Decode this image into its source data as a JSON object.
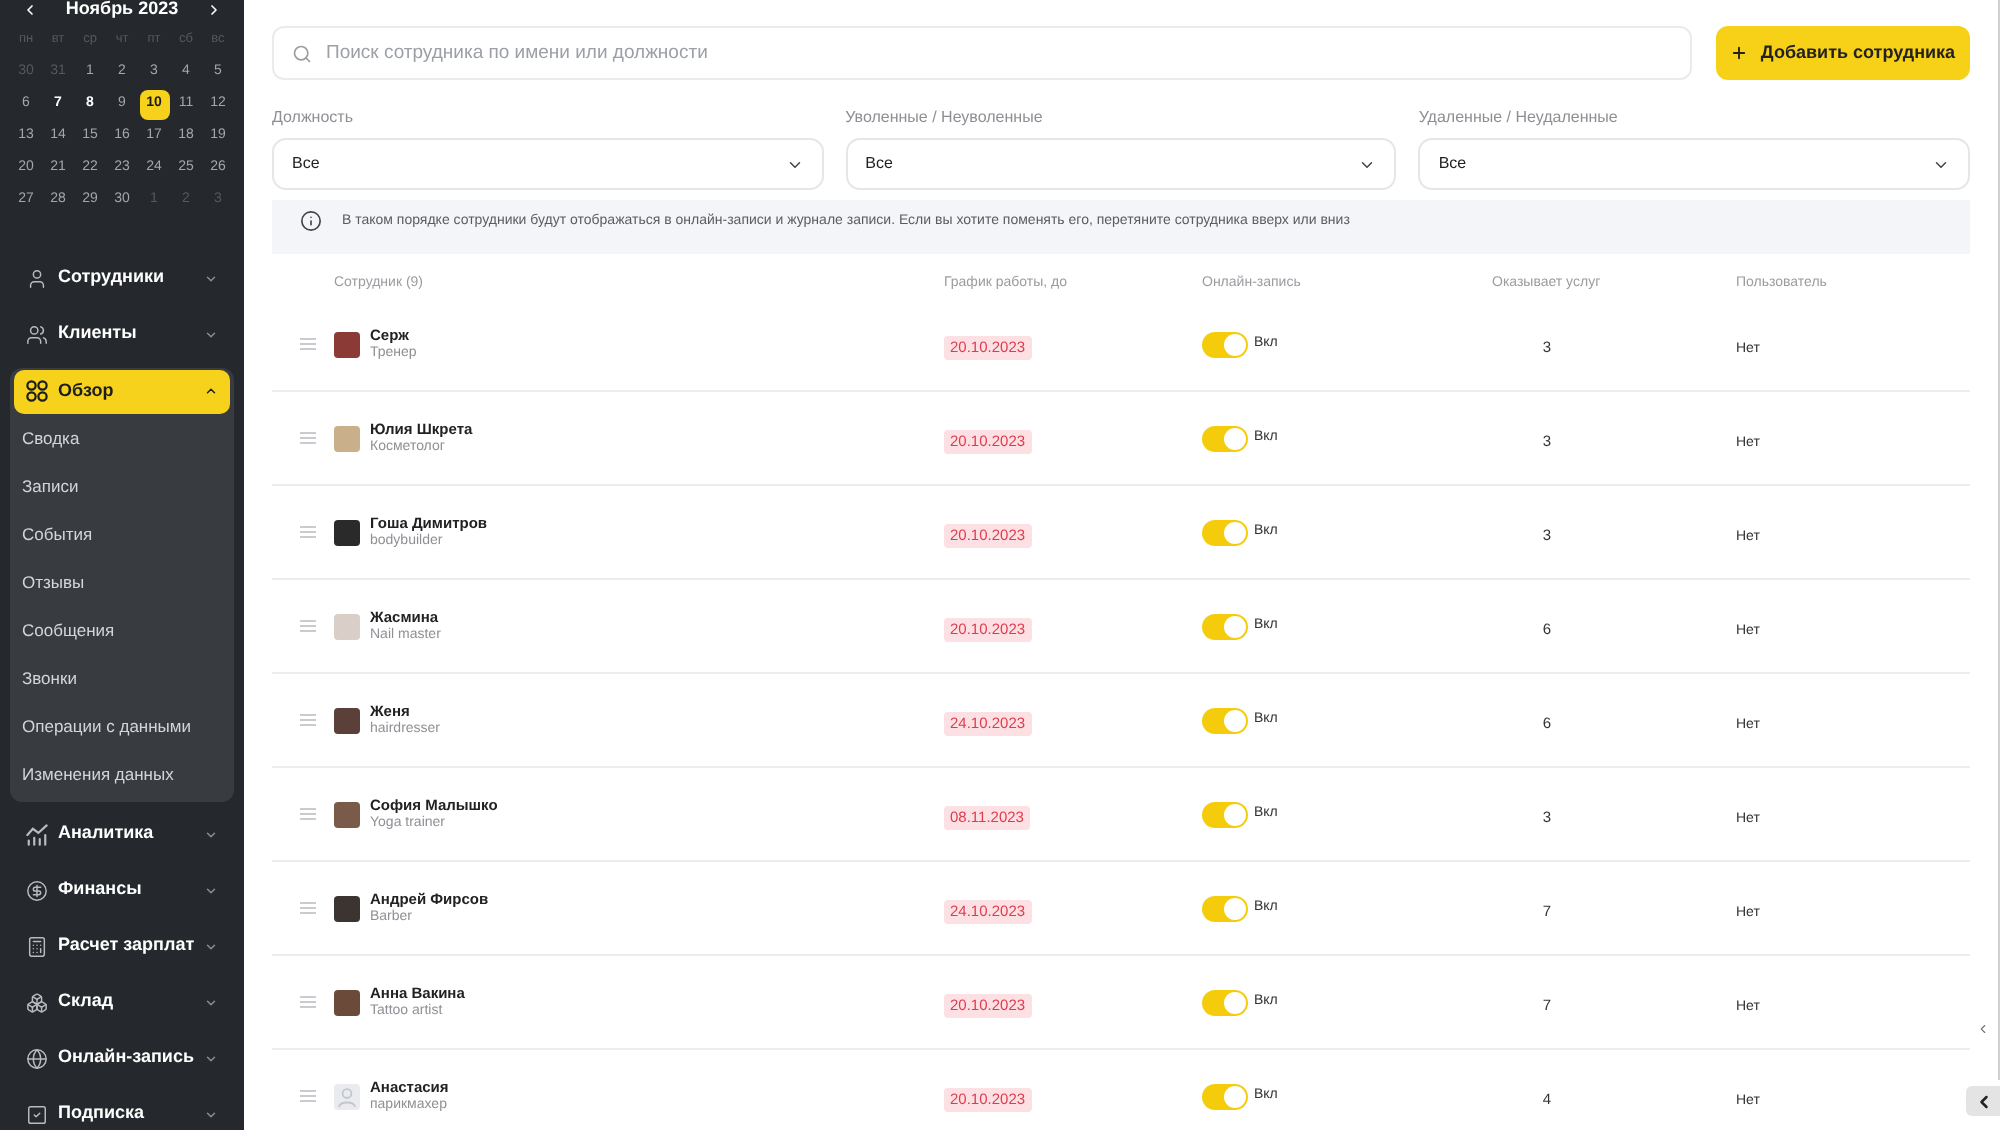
{
  "calendar": {
    "title": "Ноябрь 2023",
    "weekdays": [
      "пн",
      "вт",
      "ср",
      "чт",
      "пт",
      "сб",
      "вс"
    ],
    "days": [
      {
        "label": "30",
        "outside": true,
        "marked": false,
        "selected": false
      },
      {
        "label": "31",
        "outside": true,
        "marked": false,
        "selected": false
      },
      {
        "label": "1",
        "outside": false,
        "marked": false,
        "selected": false
      },
      {
        "label": "2",
        "outside": false,
        "marked": false,
        "selected": false
      },
      {
        "label": "3",
        "outside": false,
        "marked": false,
        "selected": false
      },
      {
        "label": "4",
        "outside": false,
        "marked": false,
        "selected": false
      },
      {
        "label": "5",
        "outside": false,
        "marked": false,
        "selected": false
      },
      {
        "label": "6",
        "outside": false,
        "marked": false,
        "selected": false
      },
      {
        "label": "7",
        "outside": false,
        "marked": true,
        "selected": false
      },
      {
        "label": "8",
        "outside": false,
        "marked": true,
        "selected": false
      },
      {
        "label": "9",
        "outside": false,
        "marked": false,
        "selected": false
      },
      {
        "label": "10",
        "outside": false,
        "marked": true,
        "selected": true
      },
      {
        "label": "11",
        "outside": false,
        "marked": false,
        "selected": false
      },
      {
        "label": "12",
        "outside": false,
        "marked": false,
        "selected": false
      },
      {
        "label": "13",
        "outside": false,
        "marked": false,
        "selected": false
      },
      {
        "label": "14",
        "outside": false,
        "marked": false,
        "selected": false
      },
      {
        "label": "15",
        "outside": false,
        "marked": false,
        "selected": false
      },
      {
        "label": "16",
        "outside": false,
        "marked": false,
        "selected": false
      },
      {
        "label": "17",
        "outside": false,
        "marked": false,
        "selected": false
      },
      {
        "label": "18",
        "outside": false,
        "marked": false,
        "selected": false
      },
      {
        "label": "19",
        "outside": false,
        "marked": false,
        "selected": false
      },
      {
        "label": "20",
        "outside": false,
        "marked": false,
        "selected": false
      },
      {
        "label": "21",
        "outside": false,
        "marked": false,
        "selected": false
      },
      {
        "label": "22",
        "outside": false,
        "marked": false,
        "selected": false
      },
      {
        "label": "23",
        "outside": false,
        "marked": false,
        "selected": false
      },
      {
        "label": "24",
        "outside": false,
        "marked": false,
        "selected": false
      },
      {
        "label": "25",
        "outside": false,
        "marked": false,
        "selected": false
      },
      {
        "label": "26",
        "outside": false,
        "marked": false,
        "selected": false
      },
      {
        "label": "27",
        "outside": false,
        "marked": false,
        "selected": false
      },
      {
        "label": "28",
        "outside": false,
        "marked": false,
        "selected": false
      },
      {
        "label": "29",
        "outside": false,
        "marked": false,
        "selected": false
      },
      {
        "label": "30",
        "outside": false,
        "marked": false,
        "selected": false
      },
      {
        "label": "1",
        "outside": true,
        "marked": false,
        "selected": false
      },
      {
        "label": "2",
        "outside": true,
        "marked": false,
        "selected": false
      },
      {
        "label": "3",
        "outside": true,
        "marked": false,
        "selected": false
      }
    ]
  },
  "sidebar": {
    "items": [
      {
        "label": "Сотрудники",
        "selected": false,
        "expanded": false
      },
      {
        "label": "Клиенты",
        "selected": false,
        "expanded": false
      },
      {
        "label": "Обзор",
        "selected": true,
        "expanded": true,
        "children": [
          {
            "label": "Сводка"
          },
          {
            "label": "Записи"
          },
          {
            "label": "События"
          },
          {
            "label": "Отзывы"
          },
          {
            "label": "Сообщения"
          },
          {
            "label": "Звонки"
          },
          {
            "label": "Операции с данными"
          },
          {
            "label": "Изменения данных"
          }
        ]
      },
      {
        "label": "Аналитика",
        "selected": false,
        "expanded": false
      },
      {
        "label": "Финансы",
        "selected": false,
        "expanded": false
      },
      {
        "label": "Расчет зарплат",
        "selected": false,
        "expanded": false
      },
      {
        "label": "Склад",
        "selected": false,
        "expanded": false
      },
      {
        "label": "Онлайн-запись",
        "selected": false,
        "expanded": false
      },
      {
        "label": "Подписка",
        "selected": false,
        "expanded": false
      }
    ]
  },
  "search": {
    "placeholder": "Поиск сотрудника по имени или должности"
  },
  "add_button": {
    "label": "Добавить сотрудника"
  },
  "filters": [
    {
      "label": "Должность",
      "value": "Все"
    },
    {
      "label": "Уволенные / Неуволенные",
      "value": "Все"
    },
    {
      "label": "Удаленные / Неудаленные",
      "value": "Все"
    }
  ],
  "notice": {
    "text": "В таком порядке сотрудники будут отображаться в онлайн-записи и журнале записи. Если вы хотите поменять его, перетяните сотрудника вверх или вниз"
  },
  "table": {
    "columns": [
      "Сотрудник (9)",
      "График работы, до",
      "Онлайн-запись",
      "Оказывает услуг",
      "Пользователь"
    ],
    "rows": [
      {
        "name": "Серж",
        "role": "Тренер",
        "has_photo": true,
        "schedule_until": "20.10.2023",
        "online_booking": {
          "on": true,
          "label": "Вкл"
        },
        "services": "3",
        "user": "Нет"
      },
      {
        "name": "Юлия Шкрета",
        "role": "Косметолог",
        "has_photo": true,
        "schedule_until": "20.10.2023",
        "online_booking": {
          "on": true,
          "label": "Вкл"
        },
        "services": "3",
        "user": "Нет"
      },
      {
        "name": "Гоша Димитров",
        "role": "bodybuilder",
        "has_photo": true,
        "schedule_until": "20.10.2023",
        "online_booking": {
          "on": true,
          "label": "Вкл"
        },
        "services": "3",
        "user": "Нет"
      },
      {
        "name": "Жасмина",
        "role": "Nail master",
        "has_photo": true,
        "schedule_until": "20.10.2023",
        "online_booking": {
          "on": true,
          "label": "Вкл"
        },
        "services": "6",
        "user": "Нет"
      },
      {
        "name": "Женя",
        "role": "hairdresser",
        "has_photo": true,
        "schedule_until": "24.10.2023",
        "online_booking": {
          "on": true,
          "label": "Вкл"
        },
        "services": "6",
        "user": "Нет"
      },
      {
        "name": "София Малышко",
        "role": "Yoga trainer",
        "has_photo": true,
        "schedule_until": "08.11.2023",
        "online_booking": {
          "on": true,
          "label": "Вкл"
        },
        "services": "3",
        "user": "Нет"
      },
      {
        "name": "Андрей Фирсов",
        "role": "Barber",
        "has_photo": true,
        "schedule_until": "24.10.2023",
        "online_booking": {
          "on": true,
          "label": "Вкл"
        },
        "services": "7",
        "user": "Нет"
      },
      {
        "name": "Анна Вакина",
        "role": "Tattoo artist",
        "has_photo": true,
        "schedule_until": "20.10.2023",
        "online_booking": {
          "on": true,
          "label": "Вкл"
        },
        "services": "7",
        "user": "Нет"
      },
      {
        "name": "Анастасия",
        "role": "парикмахер",
        "has_photo": false,
        "schedule_until": "20.10.2023",
        "online_booking": {
          "on": true,
          "label": "Вкл"
        },
        "services": "4",
        "user": "Нет"
      }
    ]
  }
}
